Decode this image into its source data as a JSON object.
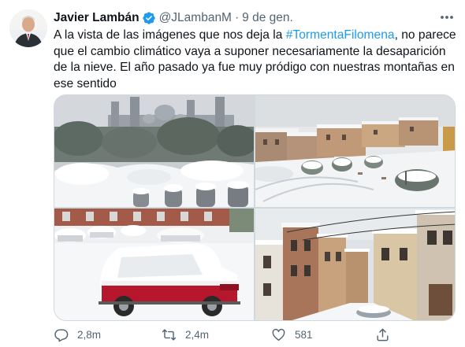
{
  "tweet": {
    "author_name": "Javier Lambán",
    "handle": "@JLambanM",
    "separator": "·",
    "date": "9 de gen.",
    "text_lines": {
      "l1_pre": "A la vista de las imágenes que nos deja la ",
      "l1_hashtag": "#TormentaFilomena",
      "l1_post": ", no parece",
      "l2": "que el cambio climático vaya a suponer necesariamente la desaparición",
      "l3": "de la nieve. El año pasado ya fue muy pródigo con nuestras montañas en",
      "l4": "ese sentido"
    },
    "accent_color": "#1d9bf0"
  },
  "actions": {
    "reply_count": "2,8m",
    "retweet_count": "2,4m",
    "like_count": "581"
  },
  "icons": {
    "verified": "verified-badge-icon",
    "more": "more-options-icon",
    "reply": "reply-icon",
    "retweet": "retweet-icon",
    "like": "heart-icon",
    "share": "share-icon"
  }
}
